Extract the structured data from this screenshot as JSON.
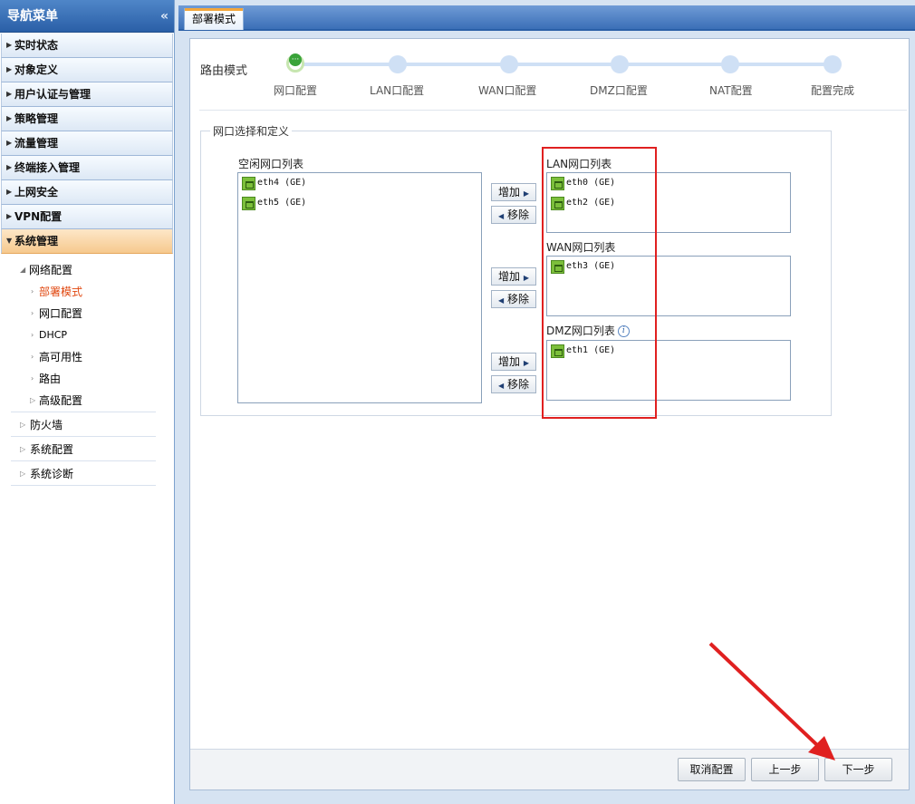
{
  "sidebar": {
    "title": "导航菜单",
    "collapse": "«",
    "items": [
      {
        "label": "实时状态"
      },
      {
        "label": "对象定义"
      },
      {
        "label": "用户认证与管理"
      },
      {
        "label": "策略管理"
      },
      {
        "label": "流量管理"
      },
      {
        "label": "终端接入管理"
      },
      {
        "label": "上网安全"
      },
      {
        "label": "VPN配置"
      },
      {
        "label": "系统管理"
      }
    ],
    "tree": {
      "network": "网络配置",
      "children": [
        "部署模式",
        "网口配置",
        "DHCP",
        "高可用性",
        "路由",
        "高级配置"
      ],
      "others": [
        "防火墙",
        "系统配置",
        "系统诊断"
      ]
    }
  },
  "tab": {
    "label": "部署模式"
  },
  "wizard": {
    "title": "路由模式",
    "steps": [
      "网口配置",
      "LAN口配置",
      "WAN口配置",
      "DMZ口配置",
      "NAT配置",
      "配置完成"
    ],
    "current_step": 0
  },
  "group": {
    "legend": "网口选择和定义",
    "free_label": "空闲网口列表",
    "free_ports": [
      "eth4 (GE)",
      "eth5 (GE)"
    ],
    "lan_label": "LAN网口列表",
    "lan_ports": [
      "eth0 (GE)",
      "eth2 (GE)"
    ],
    "wan_label": "WAN网口列表",
    "wan_ports": [
      "eth3 (GE)"
    ],
    "dmz_label": "DMZ网口列表",
    "dmz_ports": [
      "eth1 (GE)"
    ],
    "add_label": "增加",
    "remove_label": "移除",
    "info": "i"
  },
  "footer": {
    "cancel": "取消配置",
    "prev": "上一步",
    "next": "下一步"
  },
  "colors": {
    "annotation": "#e02020",
    "active_step": "#3aa33a"
  }
}
